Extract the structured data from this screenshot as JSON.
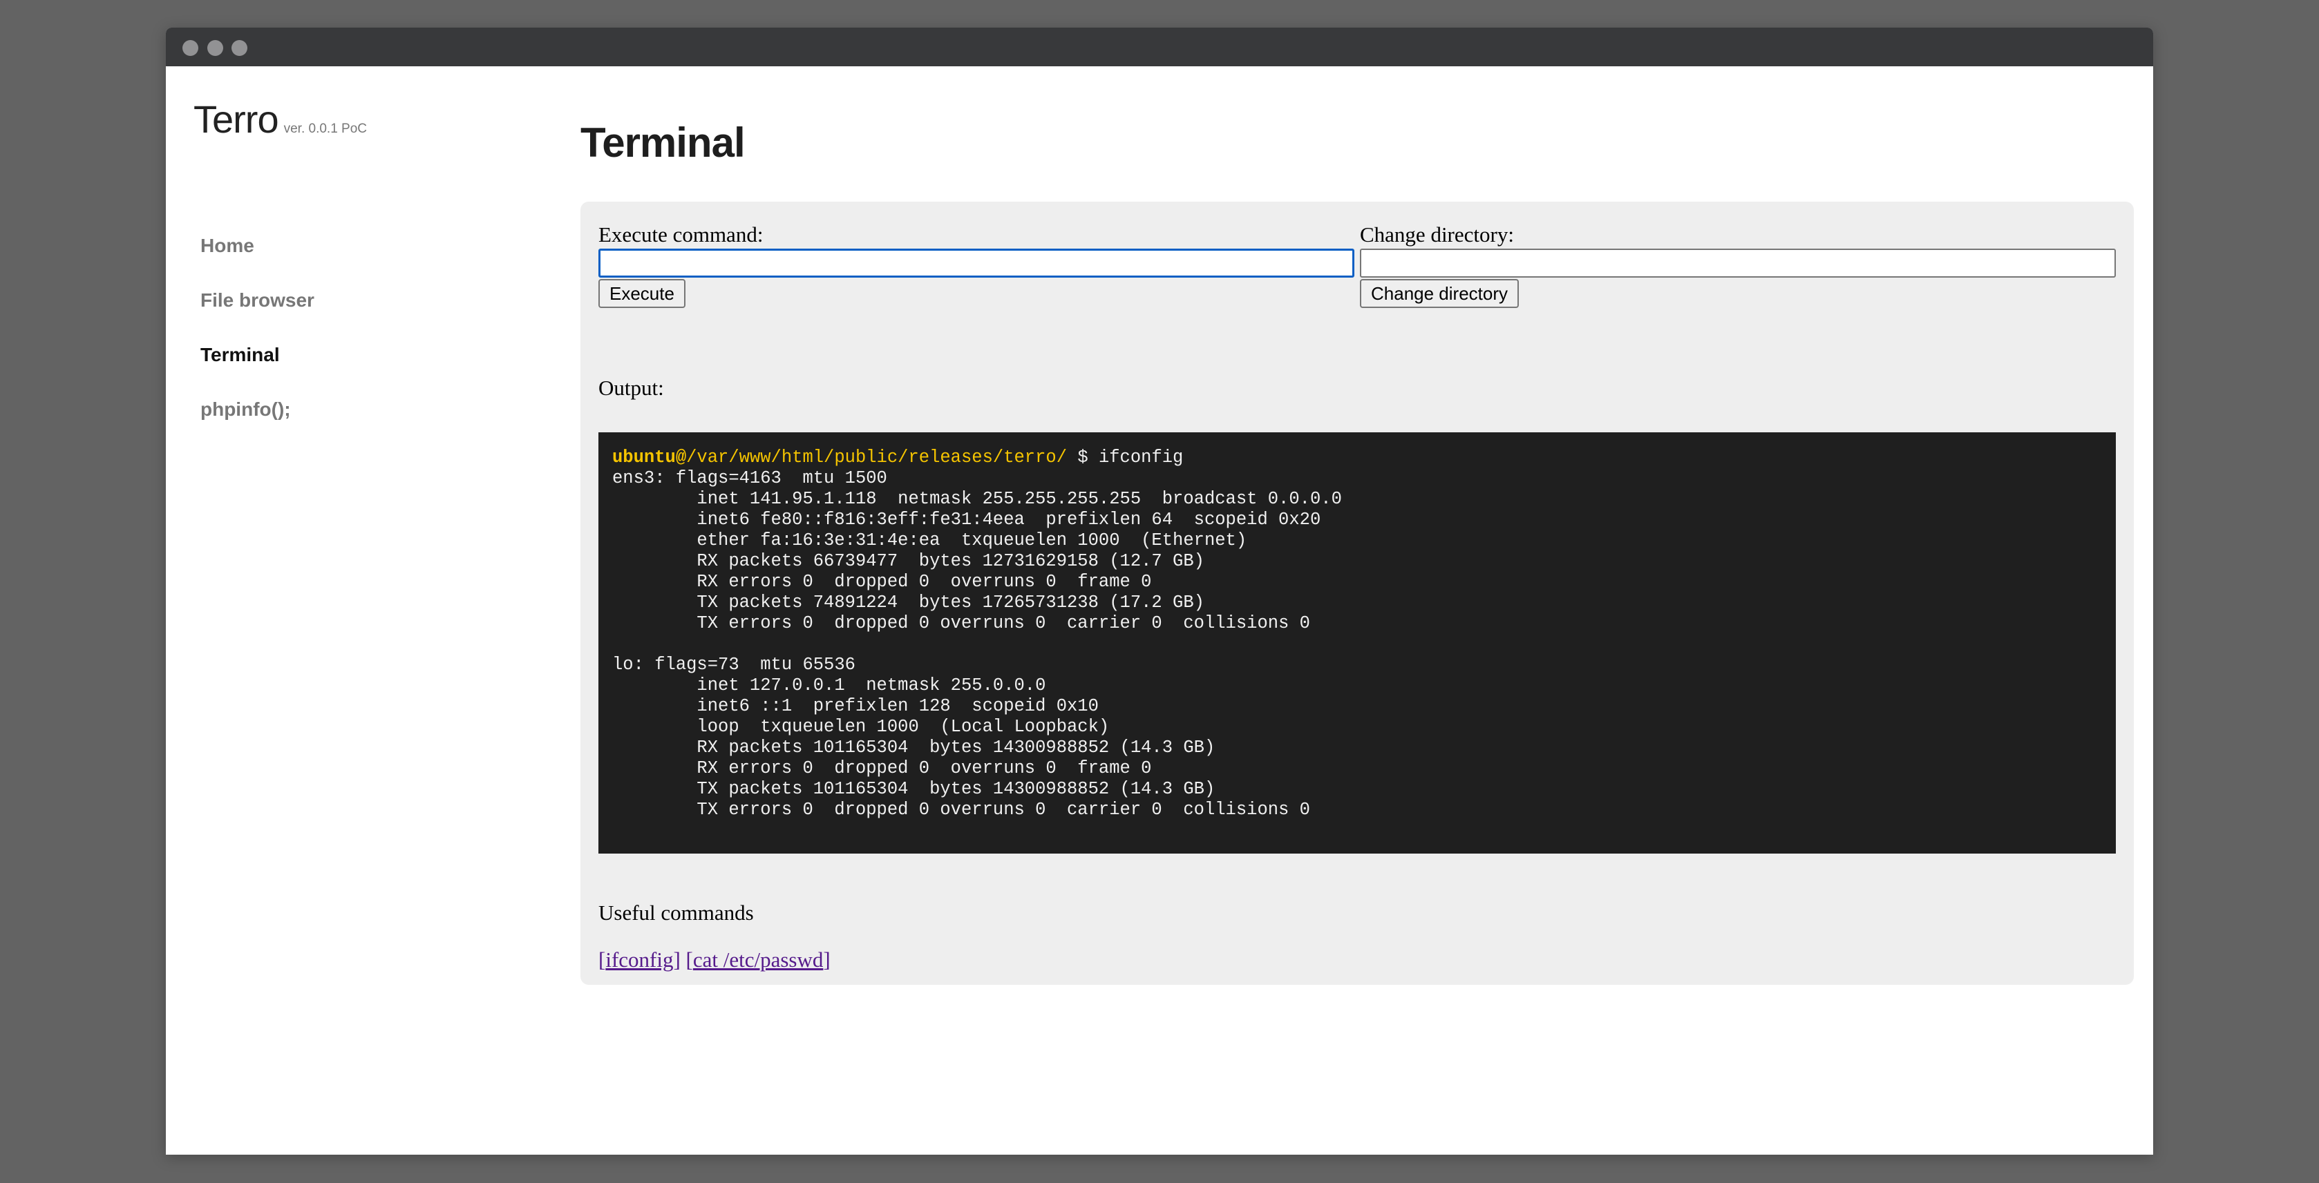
{
  "window": {
    "controls": [
      "close",
      "minimize",
      "maximize"
    ]
  },
  "brand": {
    "name": "Terro",
    "version": "ver. 0.0.1 PoC"
  },
  "nav": {
    "items": [
      {
        "label": "Home",
        "active": false
      },
      {
        "label": "File browser",
        "active": false
      },
      {
        "label": "Terminal",
        "active": true
      },
      {
        "label": "phpinfo();",
        "active": false
      }
    ]
  },
  "page": {
    "title": "Terminal"
  },
  "execute": {
    "label": "Execute command:",
    "value": "",
    "placeholder": "",
    "button": "Execute"
  },
  "chdir": {
    "label": "Change directory:",
    "value": "",
    "placeholder": "",
    "button": "Change directory"
  },
  "output": {
    "label": "Output:",
    "prompt_user": "ubuntu@",
    "prompt_path": "/var/www/html/public/releases/terro/",
    "prompt_symbol": " $ ",
    "command": "ifconfig",
    "lines": [
      "ens3: flags=4163  mtu 1500",
      "        inet 141.95.1.118  netmask 255.255.255.255  broadcast 0.0.0.0",
      "        inet6 fe80::f816:3eff:fe31:4eea  prefixlen 64  scopeid 0x20",
      "        ether fa:16:3e:31:4e:ea  txqueuelen 1000  (Ethernet)",
      "        RX packets 66739477  bytes 12731629158 (12.7 GB)",
      "        RX errors 0  dropped 0  overruns 0  frame 0",
      "        TX packets 74891224  bytes 17265731238 (17.2 GB)",
      "        TX errors 0  dropped 0 overruns 0  carrier 0  collisions 0",
      "",
      "lo: flags=73  mtu 65536",
      "        inet 127.0.0.1  netmask 255.0.0.0",
      "        inet6 ::1  prefixlen 128  scopeid 0x10",
      "        loop  txqueuelen 1000  (Local Loopback)",
      "        RX packets 101165304  bytes 14300988852 (14.3 GB)",
      "        RX errors 0  dropped 0  overruns 0  frame 0",
      "        TX packets 101165304  bytes 14300988852 (14.3 GB)",
      "        TX errors 0  dropped 0 overruns 0  carrier 0  collisions 0"
    ]
  },
  "useful": {
    "title": "Useful commands",
    "links": [
      "ifconfig",
      "cat /etc/passwd"
    ]
  },
  "colors": {
    "prompt": "#f5c400",
    "terminal_bg": "#1f1f1f",
    "panel_bg": "#eeeeee",
    "link": "#551a8b",
    "focus": "#0a5fc4"
  }
}
